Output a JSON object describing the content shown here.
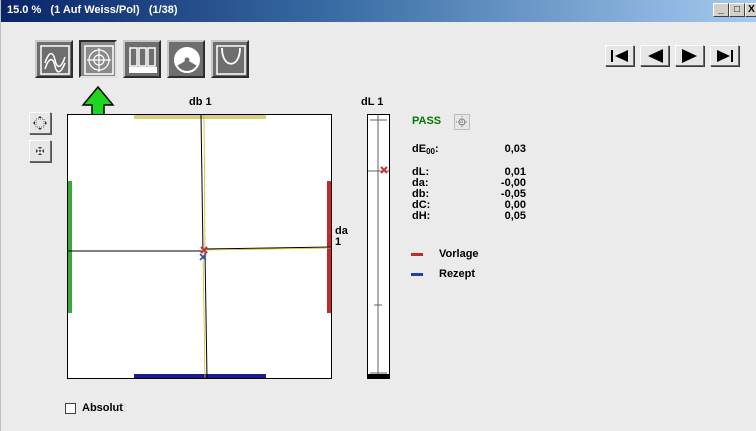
{
  "window": {
    "title": "15.0 %   (1 Auf Weiss/Pol)   (1/38)",
    "minimize_glyph": "_",
    "maximize_glyph": "□",
    "close_glyph": "X"
  },
  "toolbar": {
    "tools": [
      {
        "name": "curve-view",
        "icon": "wave-icon",
        "active": false
      },
      {
        "name": "target-view",
        "icon": "crosshair-icon",
        "active": true
      },
      {
        "name": "bars-view",
        "icon": "bars-icon",
        "active": false
      },
      {
        "name": "pie-view",
        "icon": "pie-icon",
        "active": false
      },
      {
        "name": "parabola-view",
        "icon": "parabola-icon",
        "active": false
      }
    ],
    "nav": [
      "first-icon",
      "prev-icon",
      "next-icon",
      "last-icon"
    ]
  },
  "side_buttons": [
    "zoom-out-icon",
    "zoom-in-icon"
  ],
  "chart": {
    "top_label": "db  1",
    "right_label_line1": "da",
    "right_label_line2": "1",
    "lbar_label": "dL  1",
    "colors": {
      "yellow": "#d8d070",
      "green": "#3aa83a",
      "red": "#c82828",
      "blue": "#1a1a8c",
      "target": "#c83232",
      "sample": "#3050b0"
    }
  },
  "status": {
    "label": "PASS",
    "color": "#007a00"
  },
  "metrics": [
    {
      "key": "dE",
      "sub": "00",
      "suffix": ":",
      "value": "0,03"
    },
    {
      "key": "dL:",
      "value": "0,01"
    },
    {
      "key": "da:",
      "value": "-0,00"
    },
    {
      "key": "db:",
      "value": "-0,05"
    },
    {
      "key": "dC:",
      "value": "0,00"
    },
    {
      "key": "dH:",
      "value": "0,05"
    }
  ],
  "legend": [
    {
      "label": "Vorlage",
      "color": "#c82828"
    },
    {
      "label": "Rezept",
      "color": "#2040b0"
    }
  ],
  "absolute_checkbox": {
    "label": "Absolut",
    "checked": false
  }
}
